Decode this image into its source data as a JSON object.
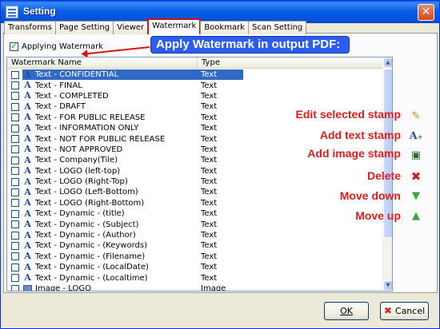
{
  "window": {
    "title": "Setting"
  },
  "tabs": [
    {
      "label": "Transforms",
      "active": false
    },
    {
      "label": "Page Setting",
      "active": false
    },
    {
      "label": "Viewer",
      "active": false
    },
    {
      "label": "Watermark",
      "active": true
    },
    {
      "label": "Bookmark",
      "active": false
    },
    {
      "label": "Scan Setting",
      "active": false
    }
  ],
  "apply": {
    "label": "Applying Watermark",
    "checked": true
  },
  "annotation": {
    "banner": "Apply Watermark in output PDF:"
  },
  "list": {
    "columns": [
      "Watermark Name",
      "Type"
    ],
    "rows": [
      {
        "name": "Text - CONFIDENTIAL",
        "type": "Text",
        "icon": "text-stamp-icon",
        "selected": true
      },
      {
        "name": "Text - FINAL",
        "type": "Text",
        "icon": "text-stamp-icon"
      },
      {
        "name": "Text - COMPLETED",
        "type": "Text",
        "icon": "text-stamp-icon"
      },
      {
        "name": "Text - DRAFT",
        "type": "Text",
        "icon": "text-stamp-icon"
      },
      {
        "name": "Text - FOR PUBLIC RELEASE",
        "type": "Text",
        "icon": "text-stamp-icon"
      },
      {
        "name": "Text - INFORMATION ONLY",
        "type": "Text",
        "icon": "text-stamp-icon"
      },
      {
        "name": "Text - NOT FOR PUBLIC RELEASE",
        "type": "Text",
        "icon": "text-stamp-icon"
      },
      {
        "name": "Text - NOT APPROVED",
        "type": "Text",
        "icon": "text-stamp-icon"
      },
      {
        "name": "Text - Company(Tile)",
        "type": "Text",
        "icon": "text-stamp-icon"
      },
      {
        "name": "Text - LOGO (left-top)",
        "type": "Text",
        "icon": "text-stamp-icon"
      },
      {
        "name": "Text - LOGO (Right-Top)",
        "type": "Text",
        "icon": "text-stamp-icon"
      },
      {
        "name": "Text - LOGO (Left-Bottom)",
        "type": "Text",
        "icon": "text-stamp-icon"
      },
      {
        "name": "Text - LOGO (Right-Bottom)",
        "type": "Text",
        "icon": "text-stamp-icon"
      },
      {
        "name": "Text - Dynamic - (title)",
        "type": "Text",
        "icon": "text-stamp-icon"
      },
      {
        "name": "Text - Dynamic - (Subject)",
        "type": "Text",
        "icon": "text-stamp-icon"
      },
      {
        "name": "Text - Dynamic - (Author)",
        "type": "Text",
        "icon": "text-stamp-icon"
      },
      {
        "name": "Text - Dynamic - (Keywords)",
        "type": "Text",
        "icon": "text-stamp-icon"
      },
      {
        "name": "Text - Dynamic - (Filename)",
        "type": "Text",
        "icon": "text-stamp-icon"
      },
      {
        "name": "Text - Dynamic - (LocalDate)",
        "type": "Text",
        "icon": "text-stamp-icon"
      },
      {
        "name": "Text - Dynamic - (Localtime)",
        "type": "Text",
        "icon": "text-stamp-icon"
      },
      {
        "name": "Image - LOGO",
        "type": "Image",
        "icon": "image-stamp-icon"
      }
    ]
  },
  "actions": [
    {
      "label": "Edit selected stamp",
      "icon": "edit-stamp-icon"
    },
    {
      "label": "Add text stamp",
      "icon": "add-text-stamp-icon"
    },
    {
      "label": "Add image stamp",
      "icon": "add-image-stamp-icon"
    },
    {
      "label": "Delete",
      "icon": "delete-icon"
    },
    {
      "label": "Move down",
      "icon": "arrow-down-icon"
    },
    {
      "label": "Move up",
      "icon": "arrow-up-icon"
    }
  ],
  "buttons": {
    "ok": "OK",
    "cancel": "Cancel"
  },
  "colors": {
    "accent": "#2d5df0",
    "annotation": "#e21c1c",
    "selection": "#316ac5"
  }
}
